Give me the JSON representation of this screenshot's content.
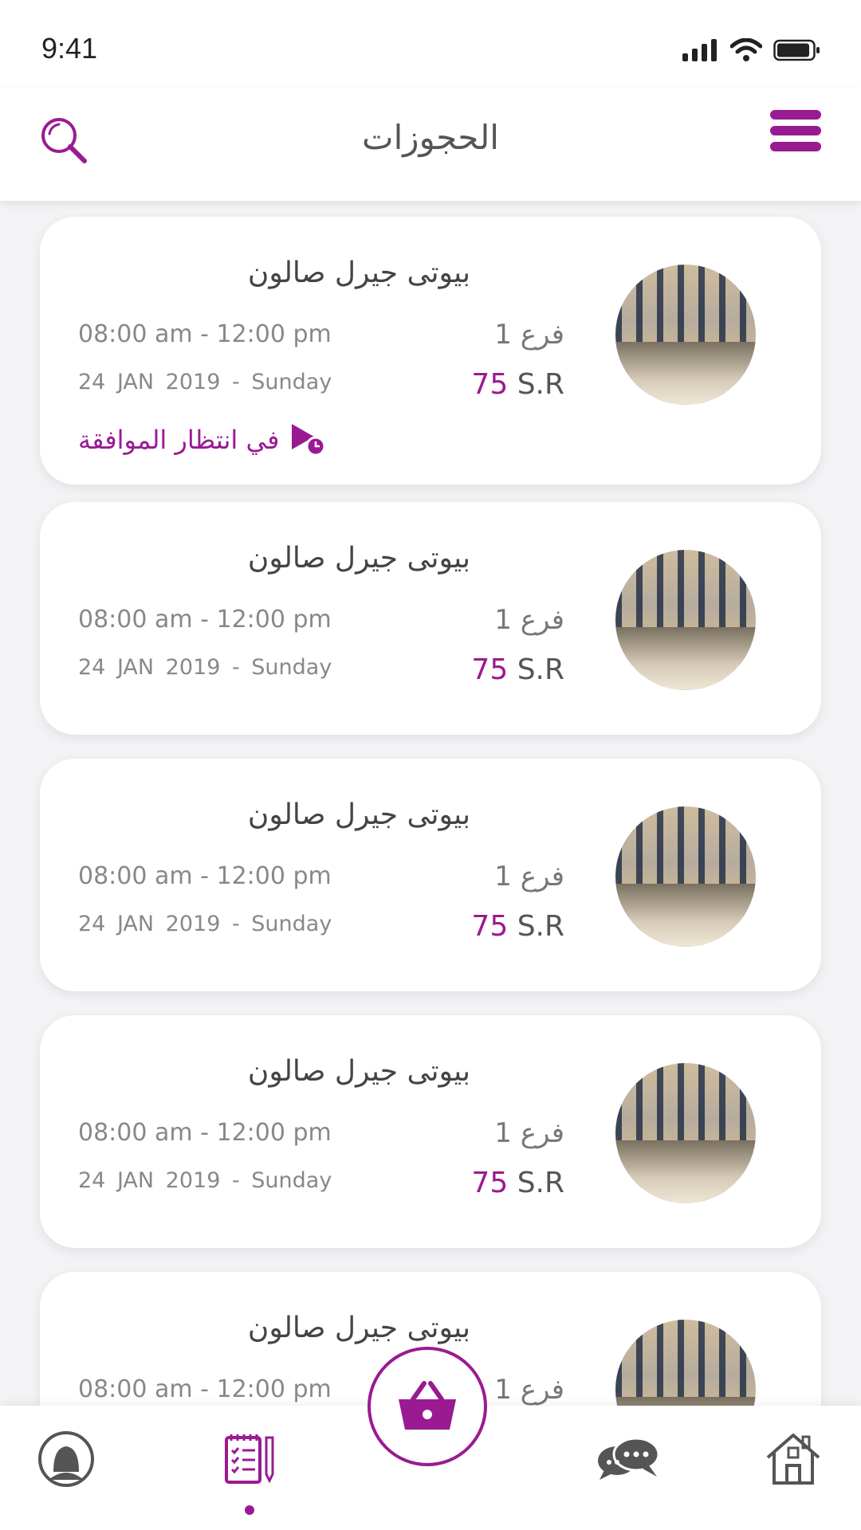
{
  "status_bar": {
    "time": "9:41"
  },
  "header": {
    "title": "الحجوزات"
  },
  "bookings": [
    {
      "salon": "بيوتى جيرل صالون",
      "branch": "فرع 1",
      "hours": "08:00 am - 12:00 pm",
      "date": "24 JAN  2019  - Sunday",
      "price_value": "75",
      "price_unit": "S.R",
      "status": "في انتظار الموافقة"
    },
    {
      "salon": "بيوتى جيرل صالون",
      "branch": "فرع 1",
      "hours": "08:00 am - 12:00 pm",
      "date": "24 JAN  2019  - Sunday",
      "price_value": "75",
      "price_unit": "S.R"
    },
    {
      "salon": "بيوتى جيرل صالون",
      "branch": "فرع 1",
      "hours": "08:00 am - 12:00 pm",
      "date": "24 JAN  2019  - Sunday",
      "price_value": "75",
      "price_unit": "S.R"
    },
    {
      "salon": "بيوتى جيرل صالون",
      "branch": "فرع 1",
      "hours": "08:00 am - 12:00 pm",
      "date": "24 JAN  2019  - Sunday",
      "price_value": "75",
      "price_unit": "S.R"
    },
    {
      "salon": "بيوتى جيرل صالون",
      "branch": "فرع 1",
      "hours": "08:00 am - 12:00 pm"
    }
  ],
  "colors": {
    "accent": "#9a1a92",
    "icon_gray": "#555555"
  },
  "tabbar": {
    "items": [
      "profile-icon",
      "bookings-icon",
      "basket-icon",
      "chat-icon",
      "home-icon"
    ],
    "active": "bookings-icon"
  }
}
